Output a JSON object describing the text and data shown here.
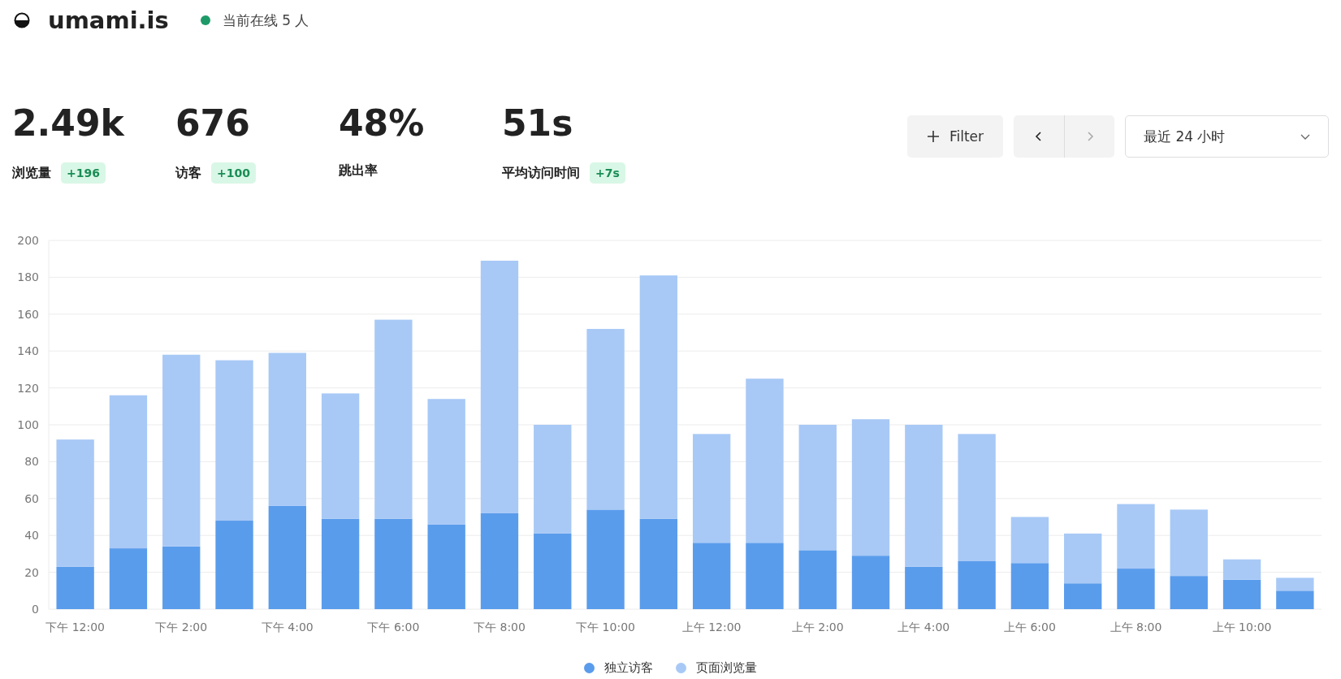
{
  "header": {
    "logo": "umami.is",
    "online": {
      "text": "当前在线 5 人",
      "color": "#1d9a68"
    }
  },
  "metrics": [
    {
      "value": "2.49k",
      "label": "浏览量",
      "change": "+196"
    },
    {
      "value": "676",
      "label": "访客",
      "change": "+100"
    },
    {
      "value": "48%",
      "label": "跳出率"
    },
    {
      "value": "51s",
      "label": "平均访问时间",
      "change": "+7s"
    }
  ],
  "toolbar": {
    "filter_button": "Filter",
    "prev": {
      "disabled": false
    },
    "next": {
      "disabled": true
    },
    "date_range": {
      "value": "最近 24 小时"
    }
  },
  "chart_data": {
    "type": "bar",
    "stacked": true,
    "grid": true,
    "categories": [
      "下午 12:00",
      null,
      "下午 2:00",
      null,
      "下午 4:00",
      null,
      "下午 6:00",
      null,
      "下午 8:00",
      null,
      "下午 10:00",
      null,
      "上午 12:00",
      null,
      "上午 2:00",
      null,
      "上午 4:00",
      null,
      "上午 6:00",
      null,
      "上午 8:00",
      null,
      "上午 10:00",
      null
    ],
    "ylim": [
      0,
      200
    ],
    "yticks": [
      0,
      20,
      40,
      60,
      80,
      100,
      120,
      140,
      160,
      180,
      200
    ],
    "series": [
      {
        "name": "独立访客",
        "color": "#5a9cec",
        "values": [
          23,
          33,
          34,
          48,
          56,
          49,
          49,
          46,
          52,
          41,
          54,
          49,
          36,
          36,
          32,
          29,
          23,
          26,
          25,
          14,
          22,
          18,
          16,
          10
        ]
      },
      {
        "name": "页面浏览量",
        "color": "#a8c9f6",
        "values": [
          69,
          83,
          104,
          87,
          83,
          68,
          108,
          68,
          137,
          59,
          98,
          132,
          59,
          89,
          68,
          74,
          77,
          69,
          25,
          27,
          35,
          36,
          11,
          7
        ]
      }
    ]
  }
}
